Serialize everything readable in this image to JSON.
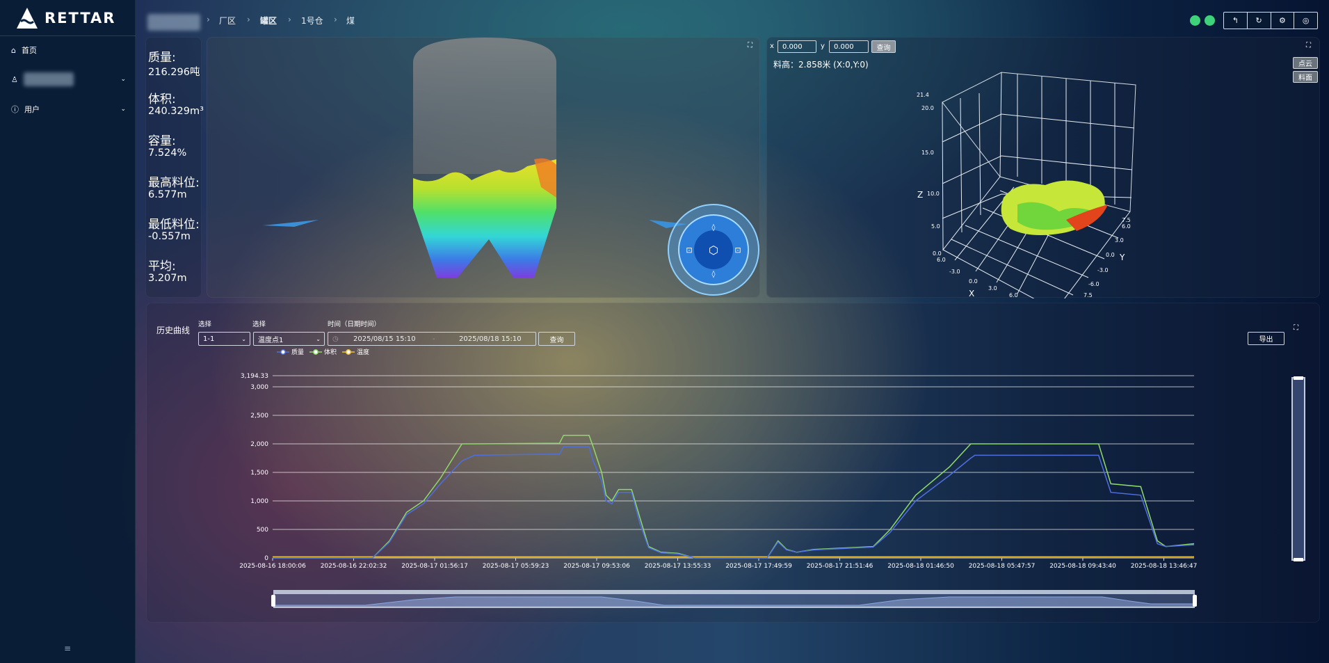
{
  "app": {
    "logo_text": "RETTAR"
  },
  "sidebar": {
    "items": [
      {
        "label": "首页",
        "icon": "home-icon"
      },
      {
        "label": "",
        "icon": "user-icon",
        "blurred": true
      },
      {
        "label": "用户",
        "icon": "info-icon"
      }
    ],
    "collapse_icon": "≡"
  },
  "breadcrumb": [
    "厂区",
    "罐区",
    "1号仓",
    "煤"
  ],
  "header": {
    "status_dots": [
      "#3ed37a",
      "#3ed37a"
    ],
    "buttons": [
      "↰",
      "↻",
      "⚙",
      "◎"
    ]
  },
  "stats": [
    {
      "label": "质量:",
      "value": "216.296吨"
    },
    {
      "label": "体积:",
      "value": "240.329m³"
    },
    {
      "label": "容量:",
      "value": "7.524%"
    },
    {
      "label": "最高料位:",
      "value": "6.577m"
    },
    {
      "label": "最低料位:",
      "value": "-0.557m"
    },
    {
      "label": "平均:",
      "value": "3.207m"
    }
  ],
  "viewer3d": {
    "x_label": "x",
    "x_value": "0.000",
    "y_label": "y",
    "y_value": "0.000",
    "query": "查询",
    "height_text": "料高：2.858米  (X:0,Y:0)",
    "btn_pointcloud": "点云",
    "btn_surface": "料面",
    "z_ticks": [
      "21.4",
      "20.0",
      "15.0",
      "10.0",
      "5.0",
      "0.0"
    ],
    "x_ticks": [
      "6.0",
      "-3.0",
      "0.0",
      "3.0",
      "6.0"
    ],
    "y_ticks": [
      "7.5",
      "6.0",
      "3.0",
      "0.0",
      "-3.0",
      "-6.0",
      "7.5"
    ],
    "axis_x": "X",
    "axis_y": "Y",
    "axis_z": "Z"
  },
  "history": {
    "title": "历史曲线",
    "select1_label": "选择",
    "select1_value": "1-1",
    "select2_label": "选择",
    "select2_value": "温度点1",
    "time_label": "时间（日期时间）",
    "date_start": "2025/08/15 15:10",
    "date_end": "2025/08/18 15:10",
    "query": "查询",
    "export": "导出"
  },
  "chart_data": {
    "type": "line",
    "ylim": [
      0,
      3194.33
    ],
    "y_ticks": [
      "0",
      "500",
      "1,000",
      "1,500",
      "2,000",
      "2,500",
      "3,000",
      "3,194.33"
    ],
    "y_tick_values": [
      0,
      500,
      1000,
      1500,
      2000,
      2500,
      3000,
      3194.33
    ],
    "x_ticks": [
      "2025-08-16 18:00:06",
      "2025-08-16 22:02:32",
      "2025-08-17 01:56:17",
      "2025-08-17 05:59:23",
      "2025-08-17 09:53:06",
      "2025-08-17 13:55:33",
      "2025-08-17 17:49:59",
      "2025-08-17 21:51:46",
      "2025-08-18 01:46:50",
      "2025-08-18 05:47:57",
      "2025-08-18 09:43:40",
      "2025-08-18 13:46:47"
    ],
    "xlim": [
      "2025-08-16 18:00",
      "2025-08-18 15:11"
    ],
    "grid": true,
    "legend": "top-left",
    "series": [
      {
        "name": "质量",
        "color": "#4f6fe0"
      },
      {
        "name": "体积",
        "color": "#8fd96a"
      },
      {
        "name": "温度",
        "color": "#f0c23a"
      }
    ],
    "points": [
      [
        "2025-08-16 18:00",
        0,
        0,
        20
      ],
      [
        "2025-08-16 22:54",
        0,
        0,
        20
      ],
      [
        "2025-08-16 23:44",
        280,
        300,
        20
      ],
      [
        "2025-08-17 00:34",
        760,
        800,
        20
      ],
      [
        "2025-08-17 01:24",
        950,
        1000,
        20
      ],
      [
        "2025-08-17 02:14",
        1300,
        1400,
        20
      ],
      [
        "2025-08-17 03:17",
        1700,
        2000,
        20
      ],
      [
        "2025-08-17 03:54",
        1800,
        2000,
        20
      ],
      [
        "2025-08-17 08:04",
        1820,
        2010,
        20
      ],
      [
        "2025-08-17 08:16",
        1950,
        2150,
        20
      ],
      [
        "2025-08-17 09:31",
        1950,
        2150,
        20
      ],
      [
        "2025-08-17 09:43",
        1700,
        1950,
        20
      ],
      [
        "2025-08-17 10:08",
        1350,
        1500,
        20
      ],
      [
        "2025-08-17 10:21",
        1000,
        1100,
        20
      ],
      [
        "2025-08-17 10:38",
        950,
        1000,
        20
      ],
      [
        "2025-08-17 10:58",
        1150,
        1200,
        20
      ],
      [
        "2025-08-17 11:36",
        1150,
        1200,
        20
      ],
      [
        "2025-08-17 12:01",
        600,
        700,
        20
      ],
      [
        "2025-08-17 12:26",
        180,
        200,
        20
      ],
      [
        "2025-08-17 13:03",
        90,
        100,
        20
      ],
      [
        "2025-08-17 13:53",
        70,
        80,
        20
      ],
      [
        "2025-08-17 14:42",
        0,
        0,
        20
      ],
      [
        "2025-08-17 18:15",
        0,
        0,
        20
      ],
      [
        "2025-08-17 18:47",
        280,
        300,
        20
      ],
      [
        "2025-08-17 19:12",
        140,
        150,
        20
      ],
      [
        "2025-08-17 19:42",
        100,
        100,
        20
      ],
      [
        "2025-08-17 20:32",
        140,
        150,
        20
      ],
      [
        "2025-08-17 23:27",
        190,
        200,
        20
      ],
      [
        "2025-08-18 00:17",
        450,
        500,
        20
      ],
      [
        "2025-08-18 01:32",
        1000,
        1100,
        20
      ],
      [
        "2025-08-18 03:12",
        1450,
        1600,
        20
      ],
      [
        "2025-08-18 04:14",
        1750,
        2000,
        20
      ],
      [
        "2025-08-18 04:26",
        1800,
        2000,
        20
      ],
      [
        "2025-08-18 10:30",
        1800,
        2000,
        20
      ],
      [
        "2025-08-18 11:06",
        1150,
        1300,
        20
      ],
      [
        "2025-08-18 12:34",
        1100,
        1250,
        20
      ],
      [
        "2025-08-18 13:23",
        250,
        300,
        20
      ],
      [
        "2025-08-18 13:48",
        200,
        200,
        20
      ],
      [
        "2025-08-18 15:11",
        230,
        250,
        20
      ]
    ]
  }
}
